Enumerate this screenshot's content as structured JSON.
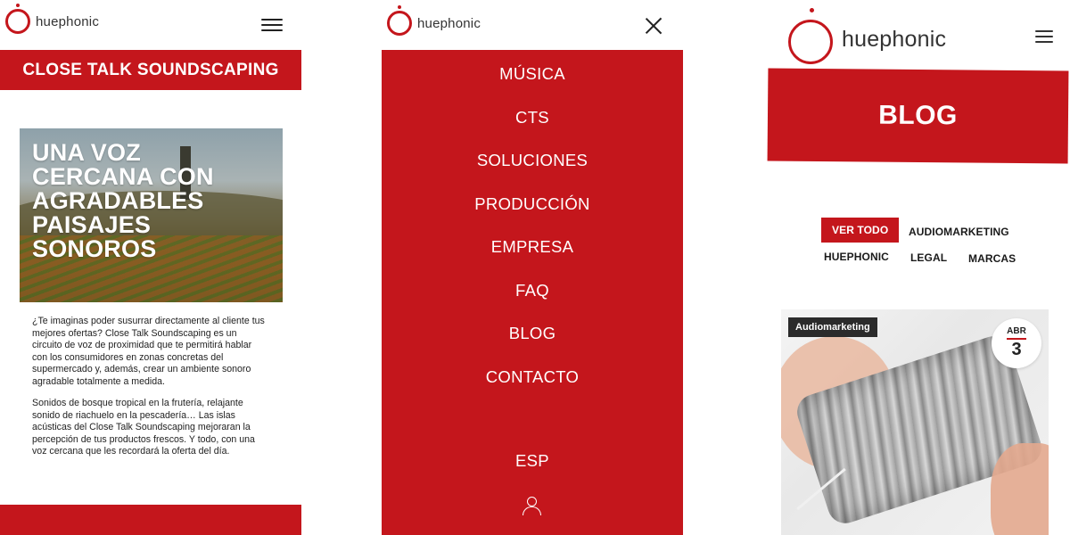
{
  "brand": {
    "name": "huephonic",
    "color": "#c4161c"
  },
  "panel1": {
    "page_title": "CLOSE TALK SOUNDSCAPING",
    "hero_lines": [
      "UNA VOZ",
      "CERCANA CON",
      "AGRADABLES",
      "PAISAJES",
      "SONOROS"
    ],
    "paragraphs": [
      "¿Te imaginas poder susurrar directamente al cliente tus mejores ofertas? Close Talk Soundscaping es un circuito de voz de proximidad que te permitirá hablar con los consumidores en zonas concretas del supermercado y, además, crear un ambiente sonoro agradable totalmente a medida.",
      "Sonidos de bosque tropical en la frutería, relajante sonido de riachuelo en la pescadería… Las islas acústicas del Close Talk Soundscaping mejoraran la percepción de tus productos frescos. Y todo, con una voz cercana que les recordará la oferta del día."
    ]
  },
  "panel2": {
    "menu_items": [
      "MÚSICA",
      "CTS",
      "SOLUCIONES",
      "PRODUCCIÓN",
      "EMPRESA",
      "FAQ",
      "BLOG",
      "CONTACTO"
    ],
    "language": "ESP"
  },
  "panel3": {
    "banner_title": "BLOG",
    "filters": [
      "VER TODO",
      "AUDIOMARKETING",
      "HUEPHONIC",
      "LEGAL",
      "MARCAS"
    ],
    "card": {
      "tag": "Audiomarketing",
      "month": "ABR",
      "day": "3"
    }
  }
}
